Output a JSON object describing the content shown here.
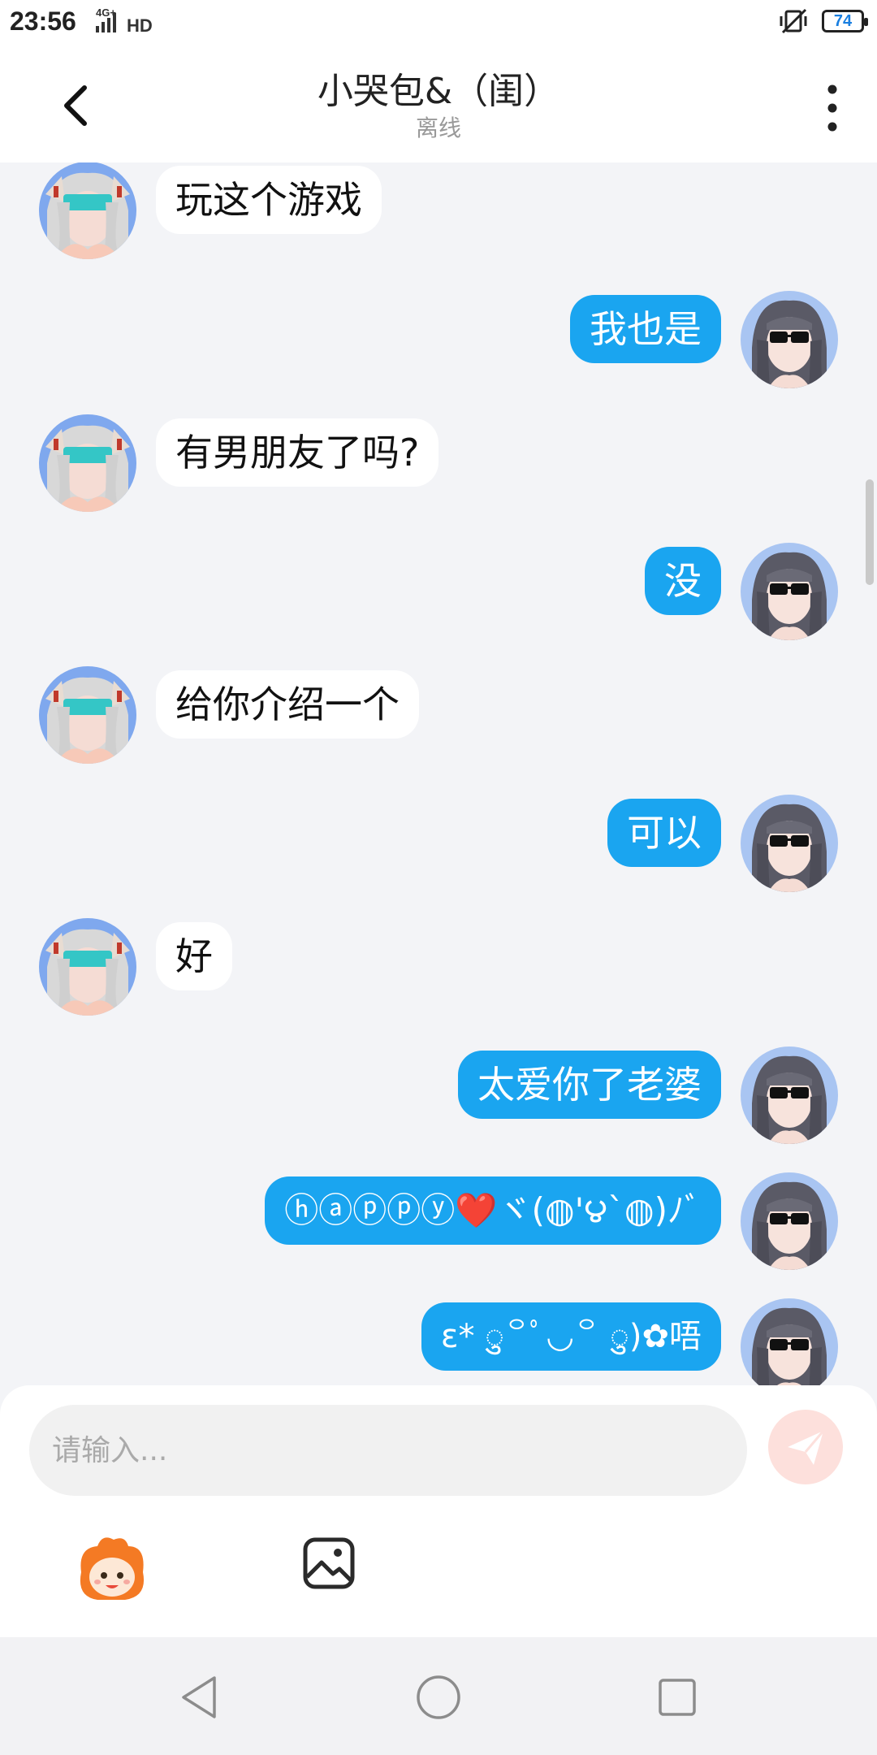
{
  "status_bar": {
    "time": "23:56",
    "network": "4G+",
    "hd": "HD",
    "battery": "74"
  },
  "header": {
    "title": "小哭包&（闺）",
    "subtitle": "离线"
  },
  "messages": [
    {
      "side": "in",
      "text": "玩这个游戏"
    },
    {
      "side": "out",
      "text": "我也是"
    },
    {
      "side": "in",
      "text": "有男朋友了吗?"
    },
    {
      "side": "out",
      "text": "没"
    },
    {
      "side": "in",
      "text": "给你介绍一个"
    },
    {
      "side": "out",
      "text": "可以"
    },
    {
      "side": "in",
      "text": "好"
    },
    {
      "side": "out",
      "text": "太爱你了老婆"
    },
    {
      "side": "out",
      "text": "ⓗⓐⓟⓟⓨ❤️ヾ(◍'౪`◍)ﾉﾞ"
    },
    {
      "side": "out",
      "text": "ε* ु꒪ﾟ◡꒪ ु)✿唔"
    }
  ],
  "composer": {
    "placeholder": "请输入..."
  },
  "icons": {
    "back": "chevron-left-icon",
    "more": "more-vertical-icon",
    "send": "send-icon",
    "emoji": "mascot-emoji-icon",
    "image": "image-icon"
  },
  "colors": {
    "outgoing_bubble": "#1aa5f0",
    "incoming_bubble": "#ffffff",
    "send_button": "#fde0dc"
  }
}
